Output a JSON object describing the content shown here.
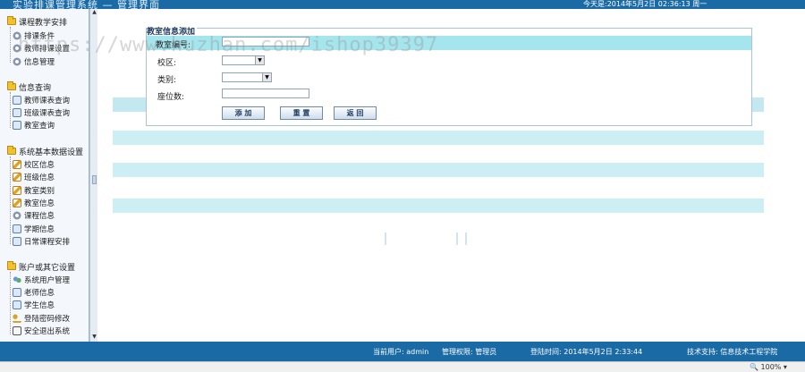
{
  "header": {
    "title": "实验排课管理系统 — 管理界面",
    "date_text": "今天是:2014年5月2日   02:36:13    周一"
  },
  "sidebar": {
    "groups": [
      {
        "title": "课程教学安排",
        "items": [
          "排课条件",
          "教师排课设置",
          "信息管理"
        ]
      },
      {
        "title": "信息查询",
        "items": [
          "教师课表查询",
          "班级课表查询",
          "教室查询"
        ]
      },
      {
        "title": "系统基本数据设置",
        "items": [
          "校区信息",
          "班级信息",
          "教室类别",
          "教室信息",
          "课程信息",
          "学期信息",
          "日常课程安排"
        ]
      },
      {
        "title": "账户或其它设置",
        "items": [
          "系统用户管理",
          "老师信息",
          "学生信息",
          "登陆密码修改",
          "安全退出系统"
        ]
      }
    ]
  },
  "form": {
    "legend": "教室信息添加",
    "fields": {
      "room_no": {
        "label": "教室编号:",
        "value": ""
      },
      "campus": {
        "label": "校区:",
        "value": ""
      },
      "category": {
        "label": "类别:",
        "value": ""
      },
      "seats": {
        "label": "座位数:",
        "value": ""
      }
    },
    "buttons": {
      "add": "添 加",
      "reset": "重 置",
      "back": "返 回"
    }
  },
  "status": {
    "current_user": "当前用户: admin",
    "permission": "管理权限: 管理员",
    "login_time": "登陆时间: 2014年5月2日 2:33:44",
    "support": "技术支持: 信息技术工程学院"
  },
  "zoom": "100%",
  "watermark": "https://www.huzhan.com/ishop39397",
  "colors": {
    "header_bg": "#1a6aa5",
    "band": "#a5e6ee",
    "grid_row": "#c4ecf2"
  }
}
